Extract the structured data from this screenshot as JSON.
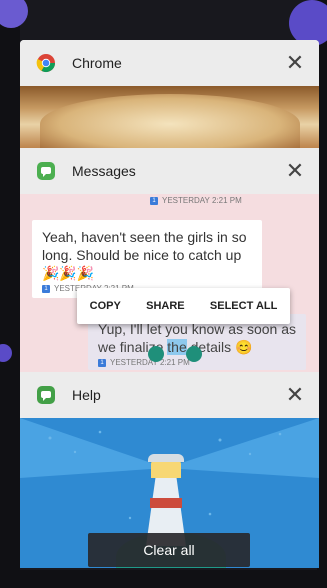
{
  "recents": {
    "cards": [
      {
        "app": "Chrome"
      },
      {
        "app": "Messages"
      },
      {
        "app": "Help"
      }
    ],
    "close_glyph": "✕"
  },
  "messages": {
    "timestamp_top": "YESTERDAY 2:21 PM",
    "incoming": "Yeah, haven't seen the girls in so long. Should be nice to catch up🎉🎉🎉",
    "timestamp_mid": "YESTERDAY 2:21 PM",
    "outgoing_pre": "Yup, I'll let you know as soon as we finalize ",
    "outgoing_selected": "the",
    "outgoing_post": " details 😊",
    "timestamp_bottom": "YESTERDAY 2:21 PM",
    "context_menu": [
      "COPY",
      "SHARE",
      "SELECT ALL"
    ]
  },
  "clear_all_label": "Clear all",
  "colors": {
    "chrome_red": "#db4437",
    "chrome_yellow": "#f4c20d",
    "chrome_green": "#0f9d58",
    "chrome_blue": "#4285f4",
    "messages_green": "#4caf50",
    "help_green": "#43a047",
    "selection_handle": "#1f8f7a"
  },
  "icons": {
    "chrome": "chrome-logo-icon",
    "messages": "messages-bubble-icon",
    "help": "help-bubble-icon",
    "close": "close-icon"
  }
}
